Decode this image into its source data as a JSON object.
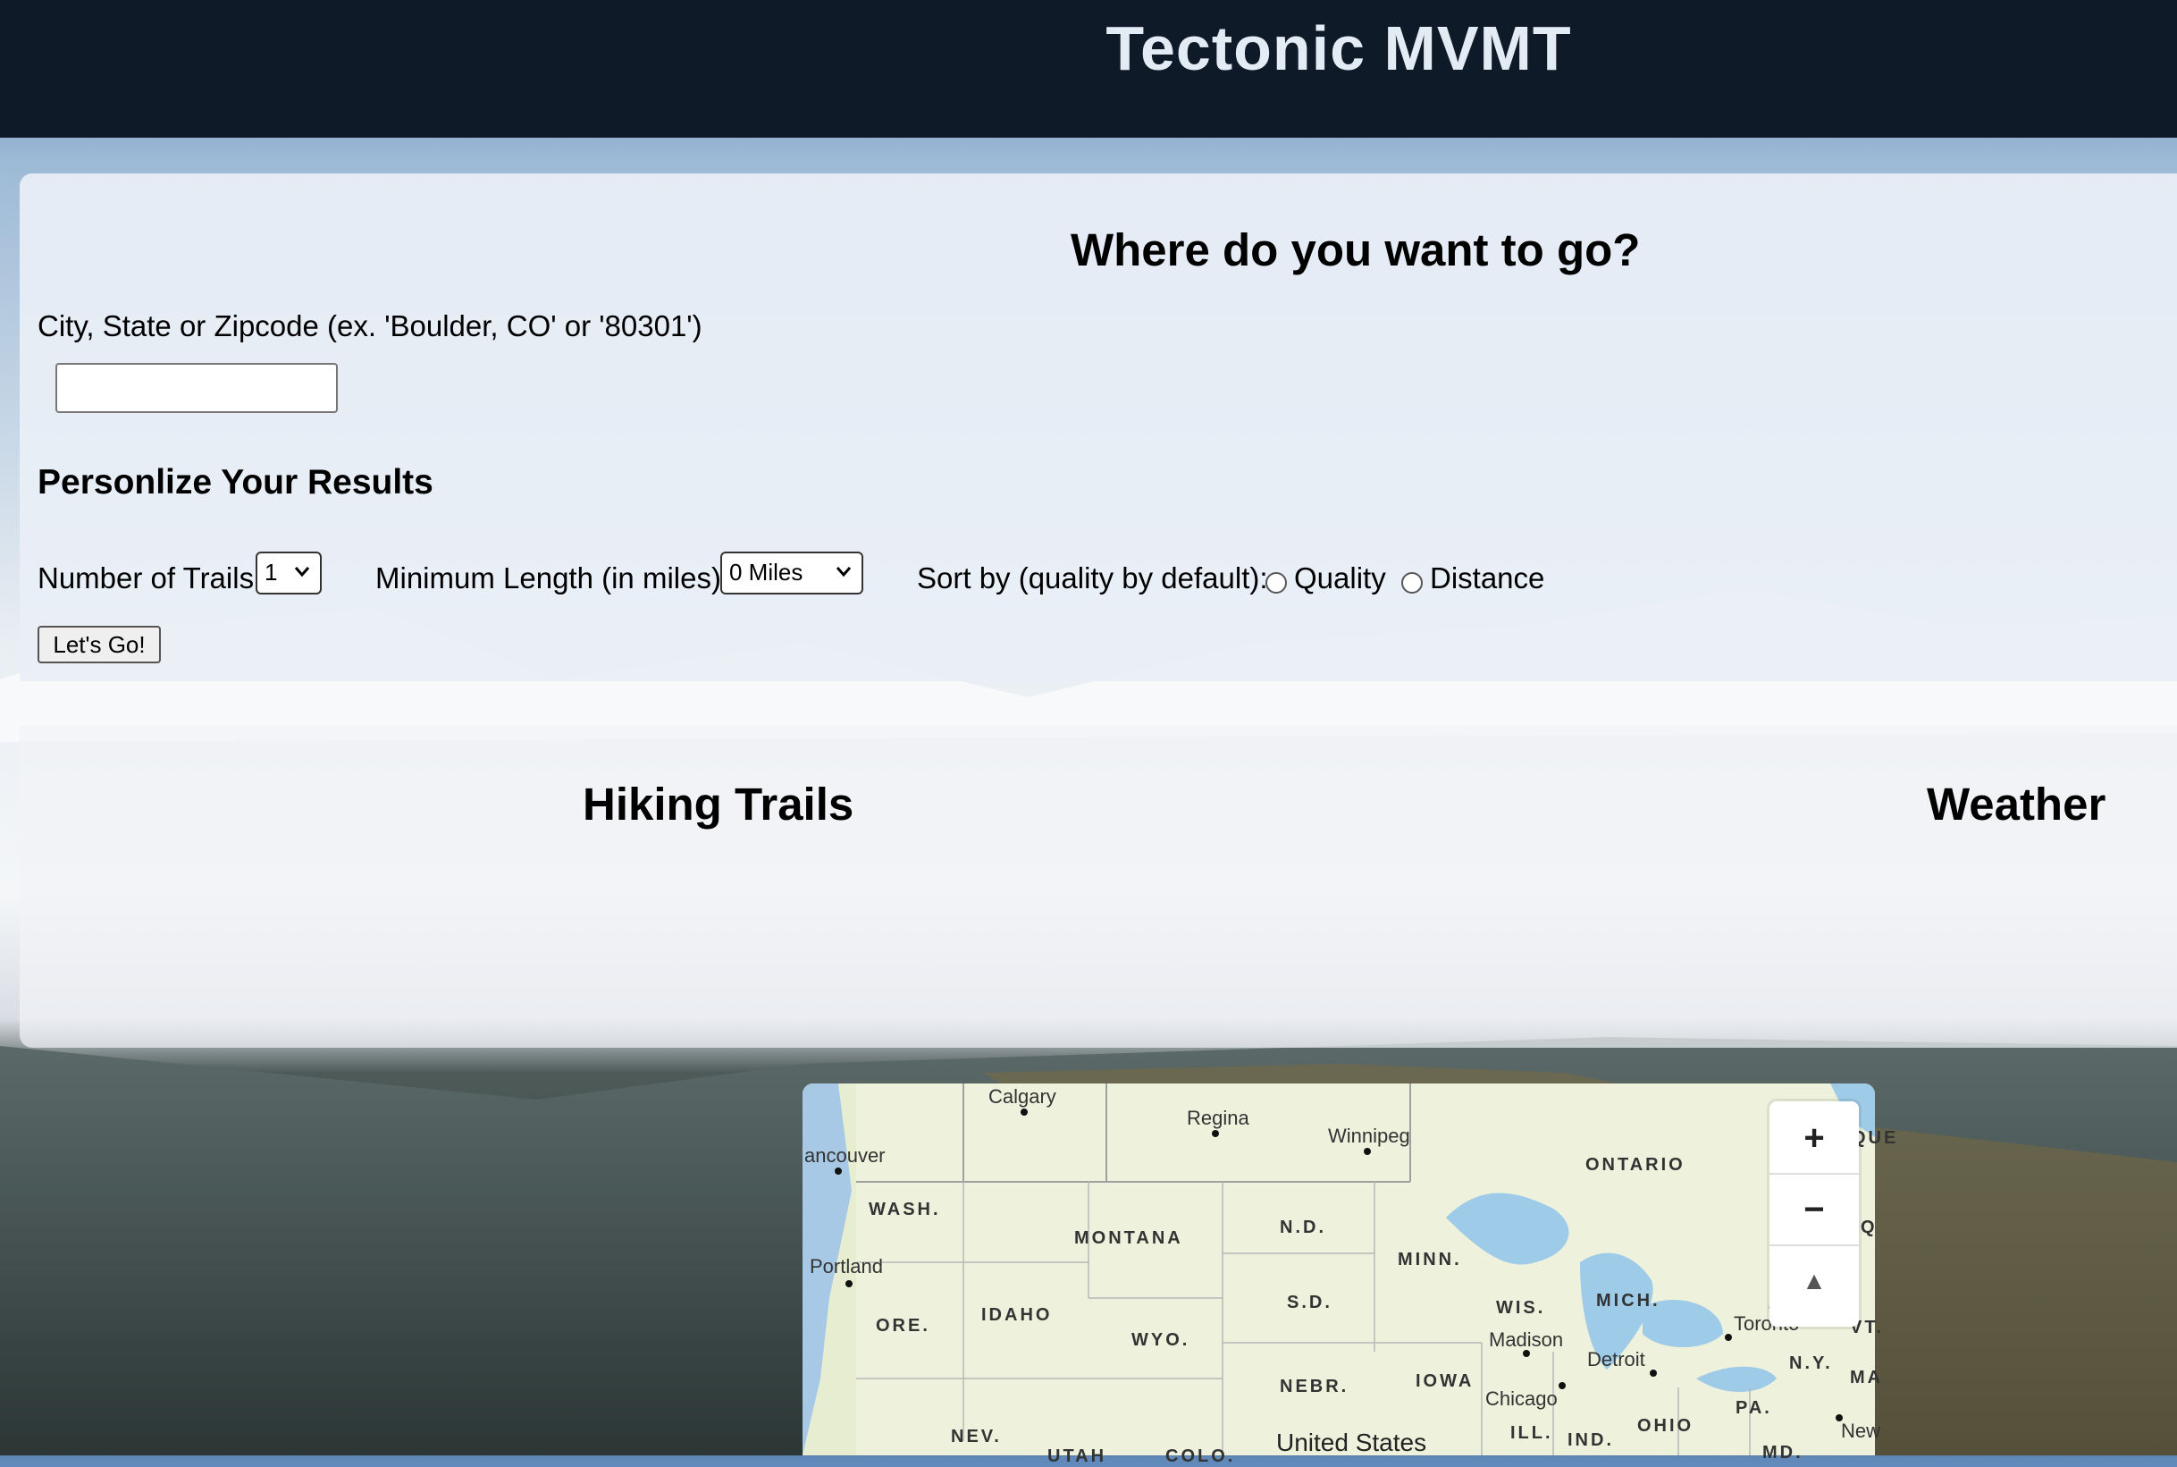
{
  "header": {
    "title": "Tectonic MVMT"
  },
  "search": {
    "heading": "Where do you want to go?",
    "location_label": "City, State or Zipcode (ex. 'Boulder, CO' or '80301')",
    "location_value": "",
    "personalize_heading": "Personlize Your Results",
    "trails_label": "Number of Trails",
    "trails_value": "1",
    "length_label": "Minimum Length (in miles)",
    "length_value": "0 Miles",
    "sort_label": "Sort by (quality by default):",
    "sort_quality": "Quality",
    "sort_distance": "Distance",
    "go_button": "Let's Go!"
  },
  "results": {
    "trails_heading": "Hiking Trails",
    "weather_heading": "Weather"
  },
  "map": {
    "cities": [
      "Calgary",
      "Regina",
      "Winnipeg",
      "ancouver",
      "Portland",
      "Madison",
      "Detroit",
      "Chicago",
      "Toronto",
      "New"
    ],
    "states": [
      "WASH.",
      "MONTANA",
      "N.D.",
      "MINN.",
      "ORE.",
      "IDAHO",
      "WYO.",
      "S.D.",
      "WIS.",
      "MICH.",
      "NEBR.",
      "IOWA",
      "ILL.",
      "IND.",
      "OHIO",
      "PA.",
      "N.Y.",
      "NEV.",
      "UTAH",
      "COLO.",
      "MD.",
      "VT.",
      "MA"
    ],
    "provinces": [
      "ONTARIO",
      "QUE",
      "Q"
    ],
    "country": "United States",
    "zoom_in": "+",
    "zoom_out": "−",
    "compass": "▲"
  }
}
